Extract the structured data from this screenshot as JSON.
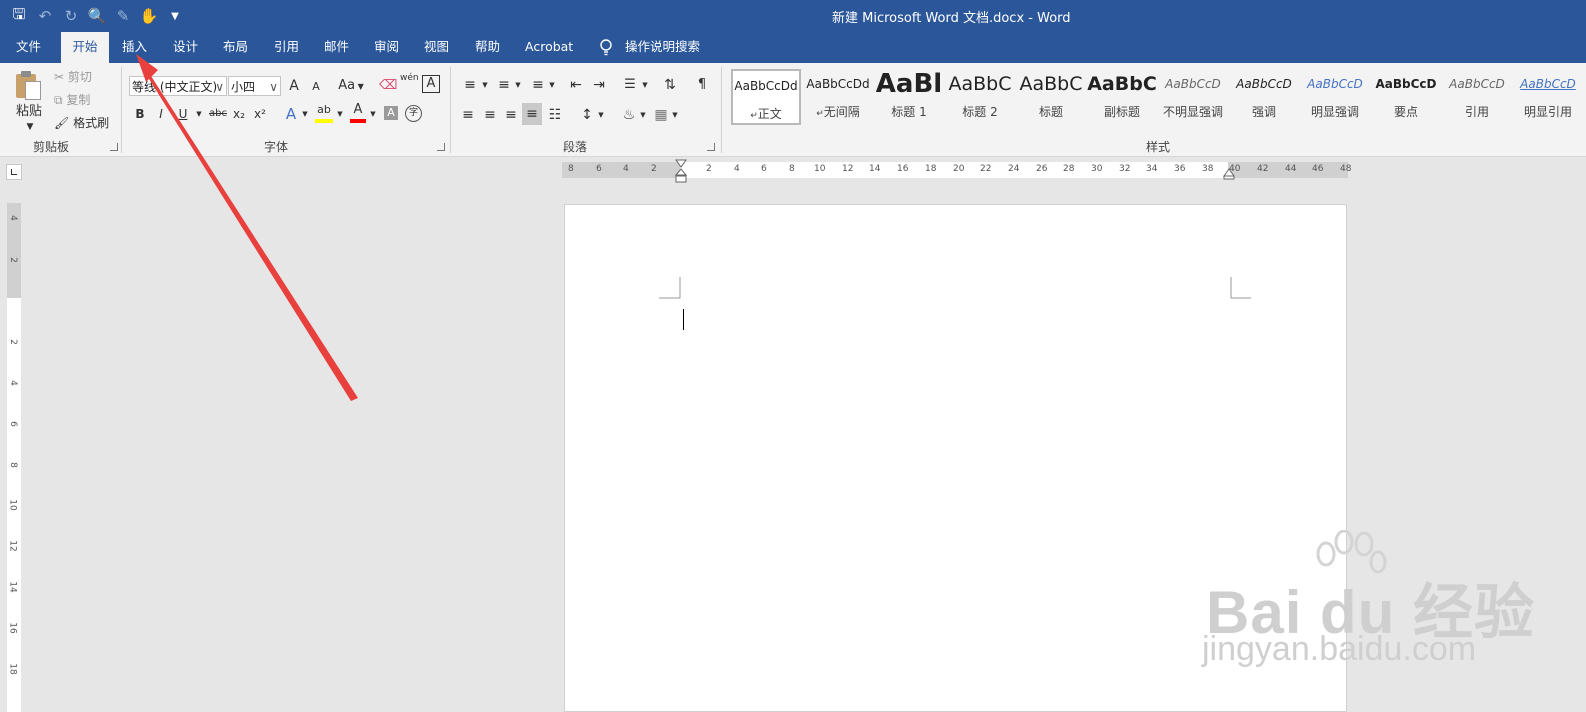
{
  "window": {
    "title": "新建 Microsoft Word 文档.docx  -  Word"
  },
  "tabs": [
    "文件",
    "开始",
    "插入",
    "设计",
    "布局",
    "引用",
    "邮件",
    "审阅",
    "视图",
    "帮助",
    "Acrobat"
  ],
  "active_tab": "开始",
  "tell_me": "操作说明搜索",
  "clipboard": {
    "paste": "粘贴",
    "cut": "剪切",
    "copy": "复制",
    "format_painter": "格式刷",
    "group": "剪贴板"
  },
  "font": {
    "name": "等线 (中文正文)",
    "size": "小四",
    "group": "字体",
    "bold": "B",
    "italic": "I",
    "underline": "U",
    "strike": "abc",
    "sub": "x₂",
    "sup": "x²",
    "grow": "A",
    "shrink": "A",
    "case": "Aa",
    "phonetic": "wén",
    "border": "A",
    "highlight": "ab",
    "color": "A",
    "shade": "A",
    "enclose": "字"
  },
  "paragraph": {
    "group": "段落"
  },
  "styles": {
    "group": "样式",
    "items": [
      {
        "sample": "AaBbCcDd",
        "name": "正文"
      },
      {
        "sample": "AaBbCcDd",
        "name": "无间隔"
      },
      {
        "sample": "AaBl",
        "name": "标题 1"
      },
      {
        "sample": "AaBbC",
        "name": "标题 2"
      },
      {
        "sample": "AaBbC",
        "name": "标题"
      },
      {
        "sample": "AaBbC",
        "name": "副标题"
      },
      {
        "sample": "AaBbCcD",
        "name": "不明显强调"
      },
      {
        "sample": "AaBbCcD",
        "name": "强调"
      },
      {
        "sample": "AaBbCcD",
        "name": "明显强调"
      },
      {
        "sample": "AaBbCcD",
        "name": "要点"
      },
      {
        "sample": "AaBbCcD",
        "name": "引用"
      },
      {
        "sample": "AaBbCcD",
        "name": "明显引用"
      }
    ]
  },
  "ruler": {
    "h_labels": [
      "8",
      "6",
      "4",
      "2",
      "2",
      "4",
      "6",
      "8",
      "10",
      "12",
      "14",
      "16",
      "18",
      "20",
      "22",
      "24",
      "26",
      "28",
      "30",
      "32",
      "34",
      "36",
      "38",
      "40",
      "42",
      "44",
      "46",
      "48"
    ],
    "v_labels": [
      "4",
      "2",
      "2",
      "4",
      "6",
      "8",
      "10",
      "12",
      "14",
      "16",
      "18"
    ]
  },
  "watermark": {
    "brand": "Bai du 经验",
    "site": "jingyan.baidu.com"
  },
  "colors": {
    "brand": "#2b579a",
    "annotation_arrow": "#e8403d",
    "highlight": "#ffff00",
    "font_color": "#ff0000"
  }
}
